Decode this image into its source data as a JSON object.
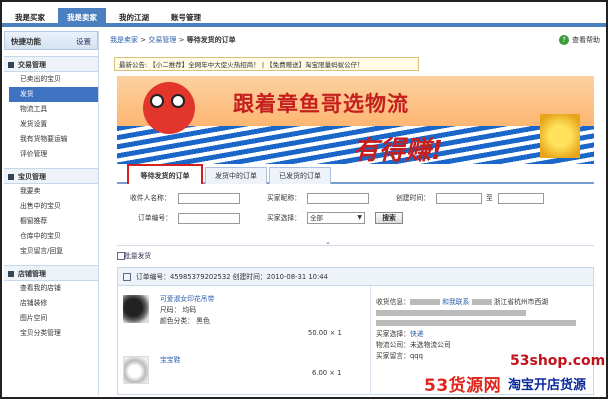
{
  "topnav": {
    "tabs": [
      {
        "label": "我是买家"
      },
      {
        "label": "我是卖家"
      },
      {
        "label": "我的江湖"
      },
      {
        "label": "账号管理"
      }
    ]
  },
  "sidebar": {
    "header": "快捷功能",
    "settings": "设置",
    "sections": [
      {
        "title": "交易管理",
        "items": [
          "已卖出的宝贝",
          "发货",
          "物流工具",
          "发货设置",
          "我有货物要运输",
          "评价管理"
        ]
      },
      {
        "title": "宝贝管理",
        "items": [
          "我要卖",
          "出售中的宝贝",
          "橱窗推荐",
          "仓库中的宝贝",
          "宝贝留言/回复"
        ]
      },
      {
        "title": "店铺管理",
        "items": [
          "查看我的店铺",
          "店铺装修",
          "图片空间",
          "宝贝分类管理"
        ]
      }
    ]
  },
  "breadcrumb": {
    "a": "我是卖家",
    "sep": ">",
    "b": "交易管理",
    "cur": "等待发货的订单"
  },
  "help": "查看帮助",
  "notice": "最新公告: 【小二推荐】全网年中大促火热招商！ | 【免费赠送】淘宝限量蚂蚁公仔！",
  "banner": {
    "line1": "跟着章鱼哥选物流",
    "line2": "有得赚!"
  },
  "tabs": [
    "等待发货的订单",
    "发货中的订单",
    "已发货的订单"
  ],
  "filter": {
    "buyer_name": "收件人名称：",
    "buyer_nick": "买家昵称：",
    "created": "创建时间：",
    "to": "至",
    "order_no": "订单编号：",
    "buyer_choice": "买家选择：",
    "select_value": "全部",
    "search": "搜索"
  },
  "batch": "批量发货",
  "order": {
    "header": "订单编号：45985379202532  创建时间：2010-08-31 10:44",
    "items": [
      {
        "title": "可爱淑女印花吊带",
        "size": "尺码：  均码",
        "color": "颜色分类：  黑色",
        "price": "50.00 × 1"
      },
      {
        "title": "宝宝鞋",
        "price": "6.00 × 1"
      }
    ],
    "receiver_label": "收货信息：",
    "wangwang": "和我联系",
    "address": "浙江省杭州市西湖",
    "buyer_select_label": "买家选择：",
    "buyer_select": "快递",
    "logistics_label": "物流公司：",
    "logistics": "未选物流公司",
    "message_label": "买家留言：",
    "message": "qqq"
  },
  "watermark": {
    "domain": "53shop.com",
    "brand": "53货源网",
    "slogan": "淘宝开店货源"
  }
}
